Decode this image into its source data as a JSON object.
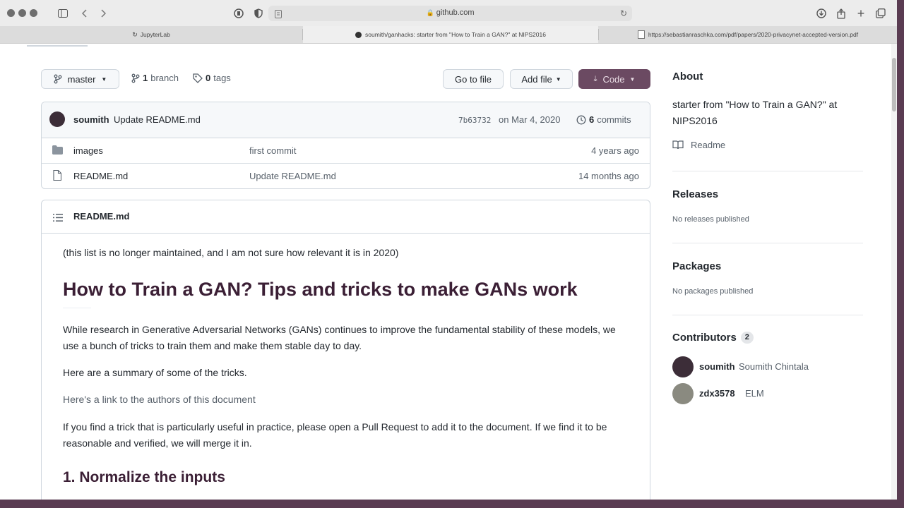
{
  "browser": {
    "url": "github.com",
    "tabs": [
      {
        "label": "JupyterLab",
        "icon": "reload-icon"
      },
      {
        "label": "soumith/ganhacks: starter from \"How to Train a GAN?\" at NIPS2016",
        "icon": "github-icon"
      },
      {
        "label": "https://sebastianraschka.com/pdf/papers/2020-privacynet-accepted-version.pdf",
        "icon": "pdf-icon"
      }
    ]
  },
  "repo": {
    "branch": "master",
    "branch_count": "1",
    "branch_label": "branch",
    "tag_count": "0",
    "tag_label": "tags",
    "go_to_file": "Go to file",
    "add_file": "Add file",
    "code": "Code"
  },
  "commit": {
    "author": "soumith",
    "message": "Update README.md",
    "hash": "7b63732",
    "date": "on Mar 4, 2020",
    "count": "6",
    "count_label": "commits"
  },
  "files": [
    {
      "name": "images",
      "message": "first commit",
      "age": "4 years ago",
      "icon": "folder-icon"
    },
    {
      "name": "README.md",
      "message": "Update README.md",
      "age": "14 months ago",
      "icon": "file-icon"
    }
  ],
  "readme": {
    "filename": "README.md",
    "note": "(this list is no longer maintained, and I am not sure how relevant it is in 2020)",
    "title": "How to Train a GAN? Tips and tricks to make GANs work",
    "p1": "While research in Generative Adversarial Networks (GANs) continues to improve the fundamental stability of these models, we use a bunch of tricks to train them and make them stable day to day.",
    "p2": "Here are a summary of some of the tricks.",
    "link": "Here's a link to the authors of this document",
    "p3": "If you find a trick that is particularly useful in practice, please open a Pull Request to add it to the document. If we find it to be reasonable and verified, we will merge it in.",
    "h2": "1. Normalize the inputs"
  },
  "sidebar": {
    "about_title": "About",
    "about_text": "starter from \"How to Train a GAN?\" at NIPS2016",
    "readme_link": "Readme",
    "releases_title": "Releases",
    "releases_text": "No releases published",
    "packages_title": "Packages",
    "packages_text": "No packages published",
    "contributors_title": "Contributors",
    "contributors_count": "2",
    "contributors": [
      {
        "login": "soumith",
        "name": "Soumith Chintala"
      },
      {
        "login": "zdx3578",
        "name": "ELM"
      }
    ]
  },
  "colors": {
    "code_button": "#6b4a62",
    "heading": "#3b1f35",
    "link": "#57606a",
    "desktop": "#5a3c52"
  }
}
